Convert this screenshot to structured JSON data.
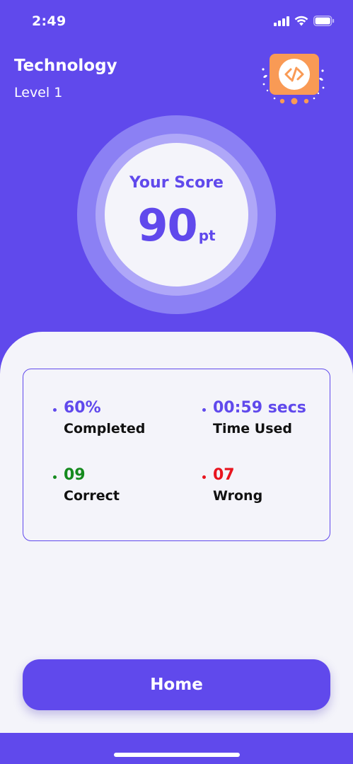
{
  "status_bar": {
    "time": "2:49"
  },
  "header": {
    "category": "Technology",
    "level": "Level 1",
    "badge_icon": "code-icon"
  },
  "score": {
    "heading": "Your Score",
    "value": "90",
    "unit": "pt"
  },
  "stats": [
    {
      "value": "60%",
      "label": "Completed",
      "color": "#6049EC"
    },
    {
      "value": "00:59 secs",
      "label": "Time Used",
      "color": "#6049EC"
    },
    {
      "value": "09",
      "label": "Correct",
      "color": "#158A1E"
    },
    {
      "value": "07",
      "label": "Wrong",
      "color": "#E8141E"
    }
  ],
  "actions": {
    "home_label": "Home"
  },
  "colors": {
    "primary": "#6049EC",
    "badge": "#F99A55",
    "sheet": "#F4F4FA"
  }
}
